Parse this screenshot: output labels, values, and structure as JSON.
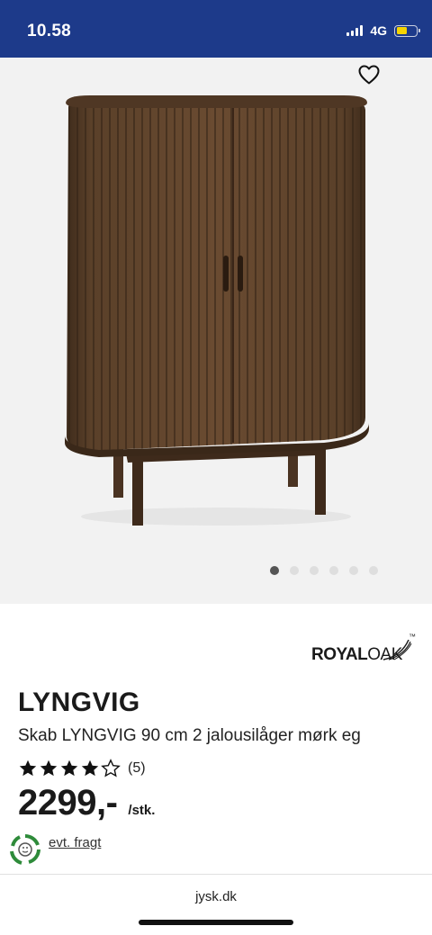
{
  "status_bar": {
    "time": "10.58",
    "network": "4G",
    "battery_level": 0.55,
    "battery_color": "#f5d400",
    "background_color": "#1d3a8a"
  },
  "gallery": {
    "wishlist_icon": "heart-outline-icon",
    "slide_count": 6,
    "active_slide": 1,
    "background_color": "#f2f2f2"
  },
  "product": {
    "brand": {
      "name_bold": "ROYAL",
      "name_light": "OAK",
      "trademark": "™"
    },
    "name": "LYNGVIG",
    "subtitle": "Skab LYNGVIG 90 cm 2 jalousilåger mørk eg",
    "rating": {
      "stars": 4,
      "max_stars": 5,
      "review_count": "(5)"
    },
    "price": "2299,-",
    "price_unit": "/stk.",
    "shipping_link": "evt. fragt",
    "shipping_icon": "eco-recycle-icon"
  },
  "browser": {
    "url": "jysk.dk"
  }
}
